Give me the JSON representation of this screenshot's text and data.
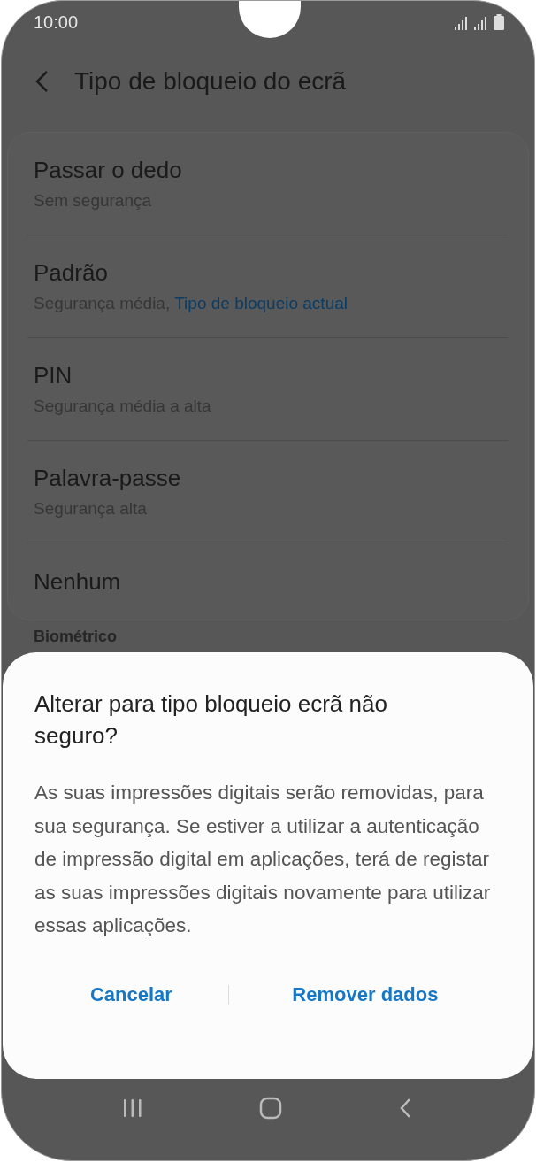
{
  "status_bar": {
    "time": "10:00"
  },
  "header": {
    "title": "Tipo de bloqueio do ecrã"
  },
  "options": [
    {
      "title": "Passar o dedo",
      "subtitle": "Sem segurança"
    },
    {
      "title": "Padrão",
      "subtitle": "Segurança média,",
      "note": "Tipo de bloqueio actual"
    },
    {
      "title": "PIN",
      "subtitle": "Segurança média a alta"
    },
    {
      "title": "Palavra-passe",
      "subtitle": "Segurança alta"
    },
    {
      "title": "Nenhum"
    }
  ],
  "section_label": "Biométrico",
  "dialog": {
    "title": "Alterar para tipo bloqueio ecrã não seguro?",
    "message": "As suas impressões digitais serão removidas, para sua segurança. Se estiver a utilizar a autenticação de impressão digital em aplicações, terá de registar as suas impressões digitais novamente para utilizar essas aplicações.",
    "buttons": [
      "Cancelar",
      "Remover dados"
    ]
  }
}
